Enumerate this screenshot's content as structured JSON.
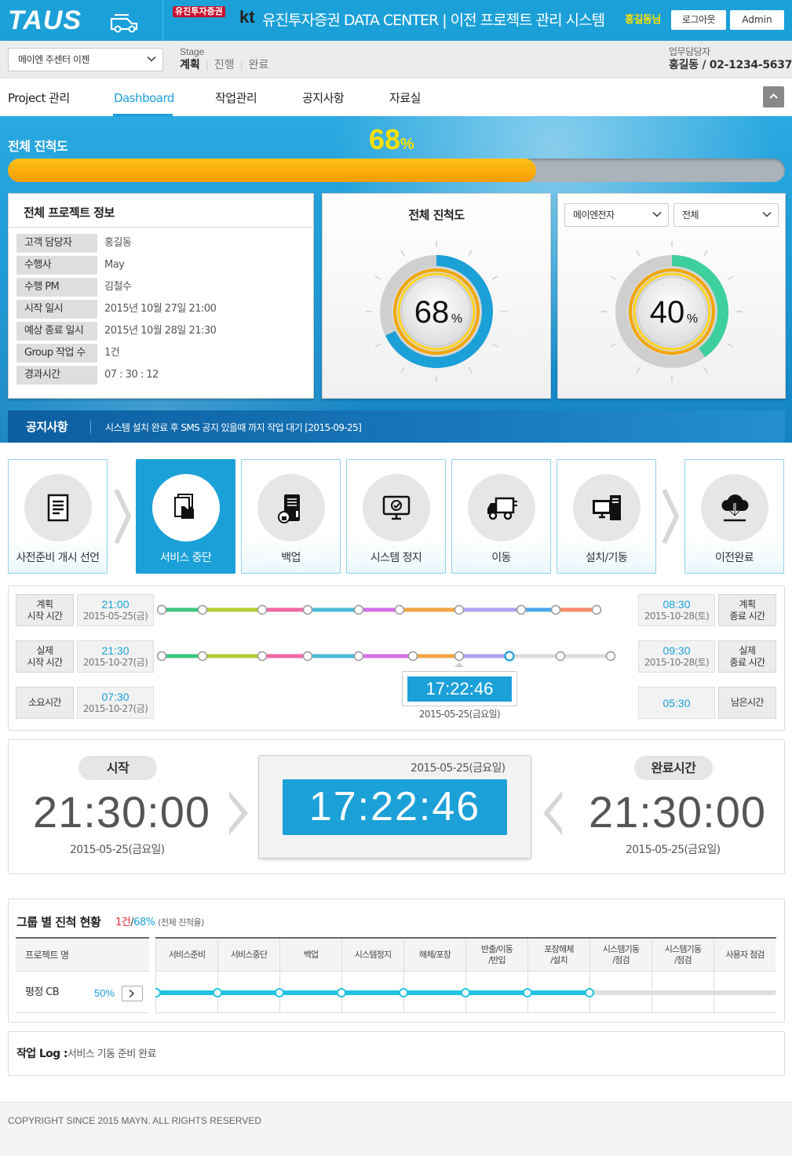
{
  "header": {
    "logo": "TAUS",
    "brand_securities": "유진투자증권",
    "brand_kt": "kt",
    "title": "유진투자증권 DATA CENTER  |  이전 프로젝트 관리 시스템",
    "user_greeting": "홍길동님",
    "logout_label": "로그아웃",
    "admin_label": "Admin"
  },
  "subheader": {
    "project_select": "메이엔 주센터 이젠",
    "stage_label": "Stage",
    "stages": [
      "계획",
      "진행",
      "완료"
    ],
    "manager_label": "업무담당자",
    "manager_value": "홍길동 / 02-1234-5637"
  },
  "nav": {
    "items": [
      "Project 관리",
      "Dashboard",
      "작업관리",
      "공지사항",
      "자료실"
    ],
    "active_index": 1
  },
  "progress": {
    "label": "전체 진척도",
    "percent": 68,
    "percent_text": "68",
    "unit": "%"
  },
  "project_info": {
    "title": "전체 프로젝트 정보",
    "rows": [
      {
        "key": "고객 담당자",
        "value": "홍길동"
      },
      {
        "key": "수행사",
        "value": "May"
      },
      {
        "key": "수행 PM",
        "value": "김철수"
      },
      {
        "key": "시작 일시",
        "value": "2015년 10월 27일 21:00"
      },
      {
        "key": "예상 종료 일시",
        "value": "2015년 10월 28일 21:30"
      },
      {
        "key": "Group 작업 수",
        "value": "1건"
      },
      {
        "key": "경과시간",
        "value": "07 : 30 : 12"
      }
    ]
  },
  "gauge_total": {
    "title": "전체 진척도",
    "percent": 68,
    "percent_text": "68",
    "unit": "%",
    "color": "#1ba0d8"
  },
  "gauge_filter": {
    "select1": "메이엔전자",
    "select2": "전체",
    "percent": 40,
    "percent_text": "40",
    "unit": "%",
    "color": "#3dcf9e"
  },
  "notice": {
    "title": "공지사항",
    "text": "시스템 설치 완료 후 SMS 공지 있을때 까지 작업 대기 [2015-09-25]"
  },
  "stages": [
    {
      "label": "사전준비 개시 선언",
      "icon": "document-icon",
      "active": false
    },
    {
      "label": "서비스 중단",
      "icon": "hand-files-icon",
      "active": true
    },
    {
      "label": "백업",
      "icon": "server-lock-icon",
      "active": false
    },
    {
      "label": "시스템 정지",
      "icon": "monitor-check-icon",
      "active": false
    },
    {
      "label": "이동",
      "icon": "truck-icon",
      "active": false
    },
    {
      "label": "설치/기동",
      "icon": "computer-tower-icon",
      "active": false
    },
    {
      "label": "이전완료",
      "icon": "cloud-download-icon",
      "active": false
    }
  ],
  "timeline": {
    "plan_start_label": "계획\n시작 시간",
    "plan_start_time": "21:00",
    "plan_start_date": "2015-05-25(금)",
    "plan_end_label": "계획\n종료 시간",
    "plan_end_time": "08:30",
    "plan_end_date": "2015-10-28(토)",
    "actual_start_label": "실제\n시작 시간",
    "actual_start_time": "21:30",
    "actual_start_date": "2015-10-27(금)",
    "actual_end_label": "실제\n종료 시간",
    "actual_end_time": "09:30",
    "actual_end_date": "2015-10-28(토)",
    "elapsed_label": "소요시간",
    "elapsed_time": "07:30",
    "elapsed_date": "2015-10-27(금)",
    "remain_label": "남은시간",
    "remain_time": "05:30",
    "current_time": "17:22:46",
    "current_date": "2015-05-25(금요일)",
    "segment_colors": [
      "#3cc67c",
      "#b3cc33",
      "#ef6aa6",
      "#4bbbd8",
      "#d56ee6",
      "#f1a443",
      "#b0a0f2",
      "#4ca6ea",
      "#f78a6a"
    ],
    "actual_done_segments": 7
  },
  "clock": {
    "start_label": "시작",
    "start_time": "21:30:00",
    "start_date": "2015-05-25(금요일)",
    "now_date": "2015-05-25(금요일)",
    "now_time": "17:22:46",
    "end_label": "완료시간",
    "end_time": "21:30:00",
    "end_date": "2015-05-25(금요일)"
  },
  "group": {
    "title": "그룹 별 진척 현황",
    "count": "1건",
    "sep": "/",
    "percent": "68%",
    "note": "(전체 진척율)",
    "col_project": "프로젝트 명",
    "columns": [
      "서비스준비",
      "서비스중단",
      "백업",
      "시스템정지",
      "해체/포장",
      "반출/이동\n/반입",
      "포장해체\n/설치",
      "시스템기동\n/점검",
      "시스템기동\n/점검",
      "사용자 점검"
    ],
    "rows": [
      {
        "name": "평정 CB",
        "percent": "50%",
        "done_steps": 8
      }
    ],
    "color": "#22c3e0"
  },
  "log": {
    "label": "작업 Log :",
    "text": "서비스 기동 준비 완료"
  },
  "footer": {
    "copyright": "COPYRIGHT SINCE 2015 MAYN. ALL RIGHTS RESERVED"
  }
}
